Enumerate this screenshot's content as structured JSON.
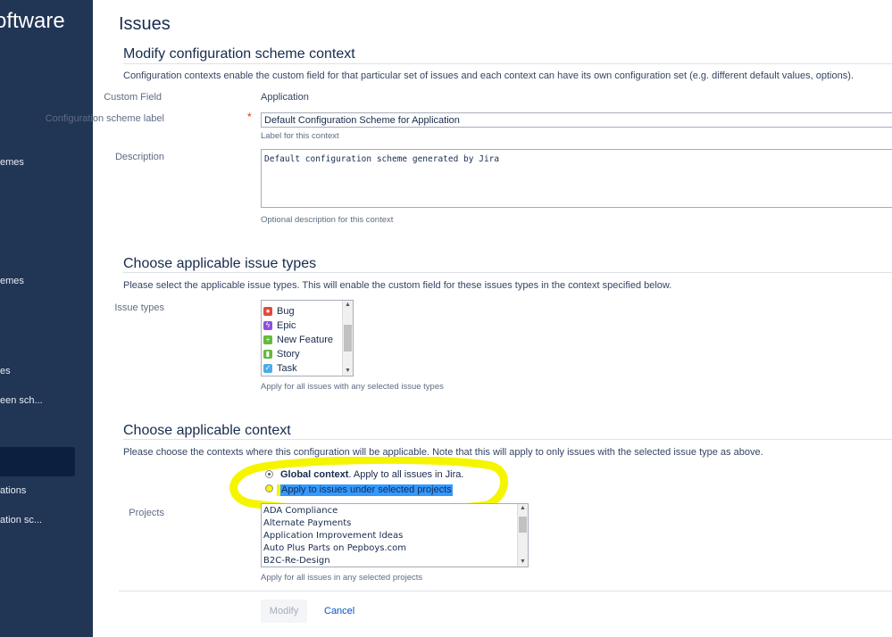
{
  "sidebar": {
    "brand": "oftware",
    "items": [
      {
        "label": "emes"
      },
      {
        "label": "emes"
      },
      {
        "label": "es"
      },
      {
        "label": "een sch..."
      },
      {
        "label": ""
      },
      {
        "label": "ations"
      },
      {
        "label": "ation sc..."
      }
    ]
  },
  "page": {
    "title": "Issues",
    "section1": {
      "heading": "Modify configuration scheme context",
      "description": "Configuration contexts enable the custom field for that particular set of issues and each context can have its own configuration set (e.g. different default values, options).",
      "custom_field_label": "Custom Field",
      "custom_field_value": "Application",
      "scheme_label_label": "Configuration scheme label",
      "scheme_label_value": "Default Configuration Scheme for Application",
      "scheme_label_help": "Label for this context",
      "description_label": "Description",
      "description_value": "Default configuration scheme generated by Jira",
      "description_help": "Optional description for this context"
    },
    "section2": {
      "heading": "Choose applicable issue types",
      "description": "Please select the applicable issue types. This will enable the custom field for these issues types in the context specified below.",
      "label": "Issue types",
      "options": [
        {
          "label": "Bug",
          "icon": "bug-icon",
          "color": "#e5493a",
          "glyph": "●"
        },
        {
          "label": "Epic",
          "icon": "epic-icon",
          "color": "#904ee2",
          "glyph": "ϟ"
        },
        {
          "label": "New Feature",
          "icon": "new-feature-icon",
          "color": "#63ba3c",
          "glyph": "+"
        },
        {
          "label": "Story",
          "icon": "story-icon",
          "color": "#63ba3c",
          "glyph": "▮"
        },
        {
          "label": "Task",
          "icon": "task-icon",
          "color": "#4bade8",
          "glyph": "✓"
        }
      ],
      "help": "Apply for all issues with any selected issue types"
    },
    "section3": {
      "heading": "Choose applicable context",
      "description": "Please choose the contexts where this configuration will be applicable. Note that this will apply to only issues with the selected issue type as above.",
      "global_bold": "Global context",
      "global_rest": ". Apply to all issues in Jira.",
      "selected_projects": "Apply to issues under selected projects",
      "projects_label": "Projects",
      "projects": [
        "ADA Compliance",
        "Alternate Payments",
        "Application Improvement Ideas",
        "Auto Plus Parts on Pepboys.com",
        "B2C-Re-Design"
      ],
      "help": "Apply for all issues in any selected projects"
    },
    "actions": {
      "modify": "Modify",
      "cancel": "Cancel"
    }
  },
  "colors": {
    "sidebar": "#213555",
    "highlight": "#f5f500",
    "selection": "#3399ff",
    "link": "#0052cc"
  }
}
